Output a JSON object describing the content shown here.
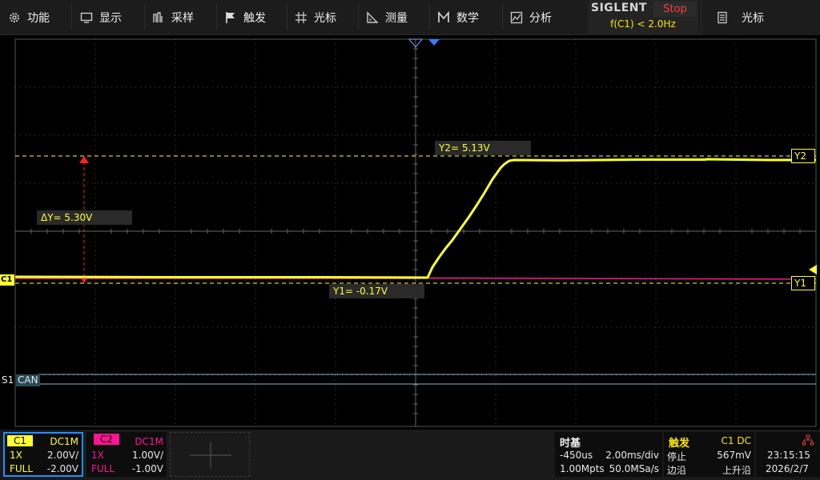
{
  "menu": {
    "items": [
      {
        "label": "功能",
        "icon": "gear-icon"
      },
      {
        "label": "显示",
        "icon": "display-icon"
      },
      {
        "label": "采样",
        "icon": "acquire-icon"
      },
      {
        "label": "触发",
        "icon": "flag-icon"
      },
      {
        "label": "光标",
        "icon": "crosshair-icon"
      },
      {
        "label": "测量",
        "icon": "ruler-icon"
      },
      {
        "label": "数学",
        "icon": "math-icon"
      },
      {
        "label": "分析",
        "icon": "analysis-icon"
      }
    ],
    "brand": "SIGLENT",
    "run_state": "Stop",
    "freq_readout": "f(C1) < 2.0Hz",
    "cursor_menu_label": "光标",
    "cursor_menu_icon": "cursor-doc-icon"
  },
  "cursors": {
    "y2_label": "Y2= 5.13V",
    "y1_label": "Y1= -0.17V",
    "delta_label": "ΔY= 5.30V",
    "y2_tag": "Y2",
    "y1_tag": "Y1"
  },
  "channel_marker": "C1",
  "serial": {
    "bus": "S1",
    "protocol": "CAN"
  },
  "channels": [
    {
      "name": "C1",
      "coupling": "DC1M",
      "probe": "1X",
      "scale": "2.00V/",
      "bandwidth": "FULL",
      "offset": "-2.00V",
      "color": "#ffff33"
    },
    {
      "name": "C2",
      "coupling": "DC1M",
      "probe": "1X",
      "scale": "1.00V/",
      "bandwidth": "FULL",
      "offset": "-1.00V",
      "color": "#ff1493"
    }
  ],
  "timebase": {
    "title": "时基",
    "delay": "-450us",
    "scale": "2.00ms/div",
    "memory": "1.00Mpts",
    "sample_rate": "50.0MSa/s"
  },
  "trigger": {
    "title": "触发",
    "source": "C1 DC",
    "state": "停止",
    "level": "567mV",
    "type": "边沿",
    "slope": "上升沿"
  },
  "clock": {
    "time": "23:15:15",
    "date": "2026/2/7",
    "network_icon": "network-icon"
  },
  "colors": {
    "ch1": "#ffff33",
    "ch2": "#ff1493",
    "cursor": "#ff2020",
    "grid": "#555555"
  }
}
